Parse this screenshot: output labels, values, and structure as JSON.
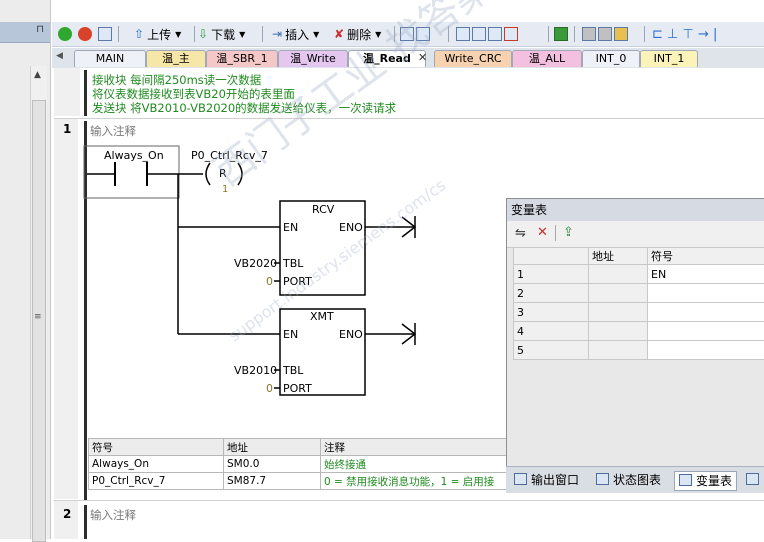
{
  "toolbar": {
    "upload": "上传",
    "download": "下载",
    "insert": "插入",
    "delete": "删除"
  },
  "tabs": [
    {
      "label": "MAIN"
    },
    {
      "label": "温_主"
    },
    {
      "label": "温_SBR_1"
    },
    {
      "label": "温_Write"
    },
    {
      "label": "温_Read"
    },
    {
      "label": "Write_CRC"
    },
    {
      "label": "温_ALL"
    },
    {
      "label": "INT_0"
    },
    {
      "label": "INT_1"
    }
  ],
  "active_tab": "温_Read",
  "block_comment": {
    "line1": "接收块  每间隔250ms读一次数据",
    "line2": "将仪表数据接收到表VB20开始的表里面",
    "line3": "发送块 将VB2010-VB2020的数据发送给仪表，一次读请求"
  },
  "network1": {
    "number": "1",
    "comment_placeholder": "输入注释",
    "contact_label": "Always_On",
    "coil_label": "P0_Ctrl_Rcv_7",
    "coil_type": "R",
    "coil_count": "1",
    "rcv": {
      "name": "RCV",
      "en": "EN",
      "eno": "ENO",
      "tbl": "TBL",
      "port": "PORT",
      "tbl_value": "VB2020",
      "port_value": "0"
    },
    "xmt": {
      "name": "XMT",
      "en": "EN",
      "eno": "ENO",
      "tbl": "TBL",
      "port": "PORT",
      "tbl_value": "VB2010",
      "port_value": "0"
    }
  },
  "symbol_table": {
    "headers": [
      "符号",
      "地址",
      "注释"
    ],
    "rows": [
      [
        "Always_On",
        "SM0.0",
        "始终接通"
      ],
      [
        "P0_Ctrl_Rcv_7",
        "SM87.7",
        "0 = 禁用接收消息功能，1 = 启用接"
      ]
    ]
  },
  "network2": {
    "number": "2",
    "comment_placeholder": "输入注释"
  },
  "variable_table": {
    "title": "变量表",
    "headers": [
      "",
      "地址",
      "符号"
    ],
    "rows": [
      [
        "1",
        "",
        "EN"
      ],
      [
        "2",
        "",
        ""
      ],
      [
        "3",
        "",
        ""
      ],
      [
        "4",
        "",
        ""
      ],
      [
        "5",
        "",
        ""
      ]
    ]
  },
  "dock_tabs": [
    {
      "label": "输出窗口"
    },
    {
      "label": "状态图表"
    },
    {
      "label": "变量表"
    }
  ],
  "watermark": {
    "text": "西门子工业 找答案",
    "url": "support.industry.siemens.com/cs"
  }
}
